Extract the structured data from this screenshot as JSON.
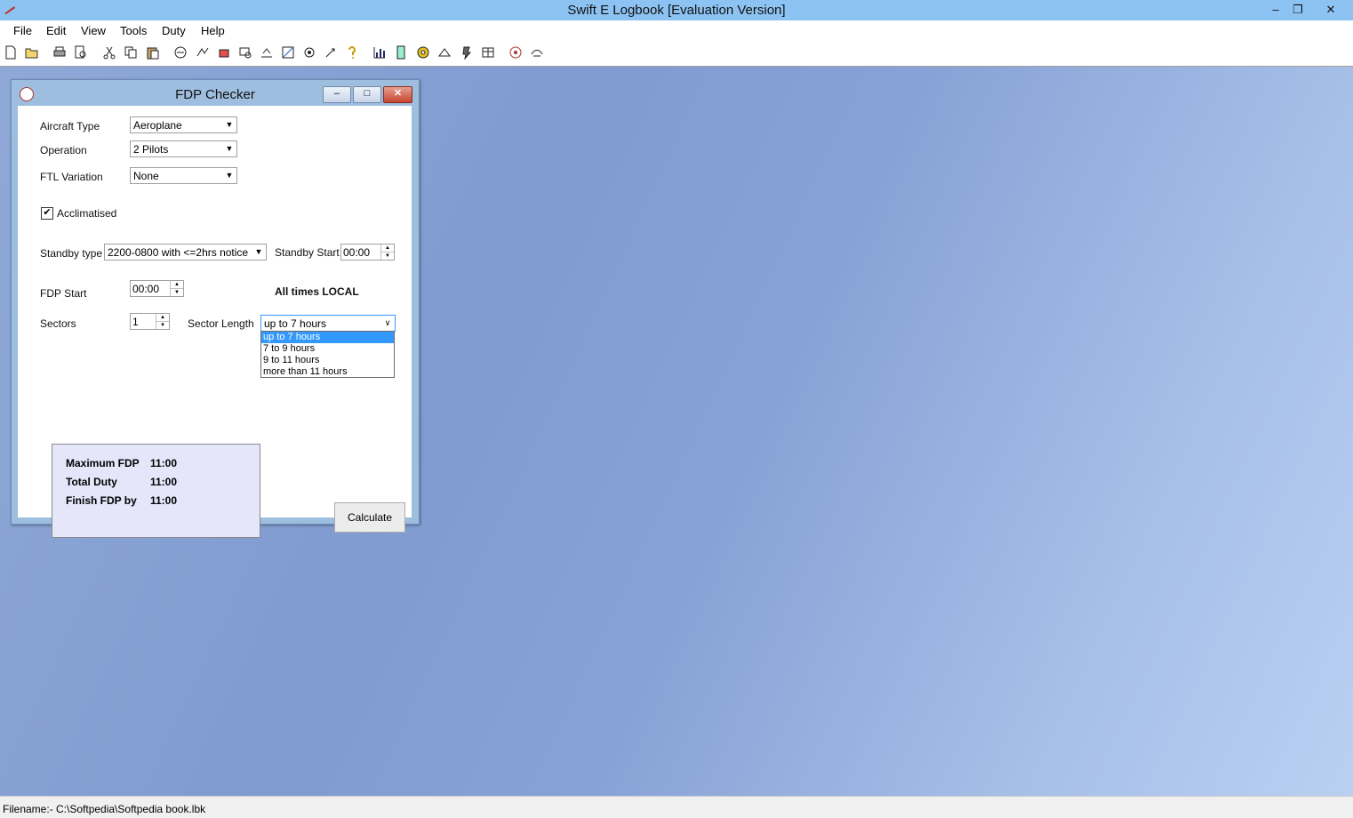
{
  "window": {
    "title": "Swift E Logbook [Evaluation Version]",
    "minimize": "–",
    "restore": "❐",
    "close": "✕"
  },
  "menu": [
    "File",
    "Edit",
    "View",
    "Tools",
    "Duty",
    "Help"
  ],
  "toolbar": [
    "new-icon",
    "open-icon",
    "print-icon",
    "print-preview-icon",
    "cut-icon",
    "copy-icon",
    "paste-icon",
    "tool-icon-1",
    "tool-icon-2",
    "tool-icon-3",
    "tool-icon-4",
    "tool-icon-5",
    "tool-icon-6",
    "tool-icon-7",
    "tool-icon-8",
    "help-icon",
    "chart-icon",
    "calculator-icon",
    "settings-icon",
    "tool-icon-9",
    "tool-icon-10",
    "tool-icon-11",
    "tool-icon-12",
    "tool-icon-13"
  ],
  "dialog": {
    "title": "FDP Checker",
    "minimize": "–",
    "restore": "□",
    "close": "✕",
    "aircraft_type": {
      "label": "Aircraft Type",
      "value": "Aeroplane"
    },
    "operation": {
      "label": "Operation",
      "value": "2 Pilots"
    },
    "ftl_variation": {
      "label": "FTL Variation",
      "value": "None"
    },
    "acclimatised": {
      "label": "Acclimatised",
      "checked": true,
      "mark": "✔"
    },
    "standby_type": {
      "label": "Standby type",
      "value": "2200-0800 with <=2hrs notice"
    },
    "standby_start": {
      "label": "Standby Start",
      "value": "00:00"
    },
    "fdp_start": {
      "label": "FDP Start",
      "value": "00:00"
    },
    "all_times": "All times LOCAL",
    "sectors": {
      "label": "Sectors",
      "value": "1"
    },
    "sector_length": {
      "label": "Sector Length",
      "value": "up to 7 hours",
      "options": [
        "up to 7 hours",
        "7 to 9 hours",
        "9 to 11 hours",
        "more than 11 hours"
      ],
      "selected_index": 0
    },
    "results": {
      "max_fdp_label": "Maximum FDP",
      "max_fdp_value": "11:00",
      "total_duty_label": "Total Duty",
      "total_duty_value": "11:00",
      "finish_label": "Finish FDP by",
      "finish_value": "11:00"
    },
    "calculate_label": "Calculate"
  },
  "status": {
    "filename": "Filename:- C:\\Softpedia\\Softpedia book.lbk"
  },
  "colors": {
    "title_bar": "#8dc3f2",
    "selection": "#3399ff",
    "result_bg": "#e6e6fb"
  }
}
